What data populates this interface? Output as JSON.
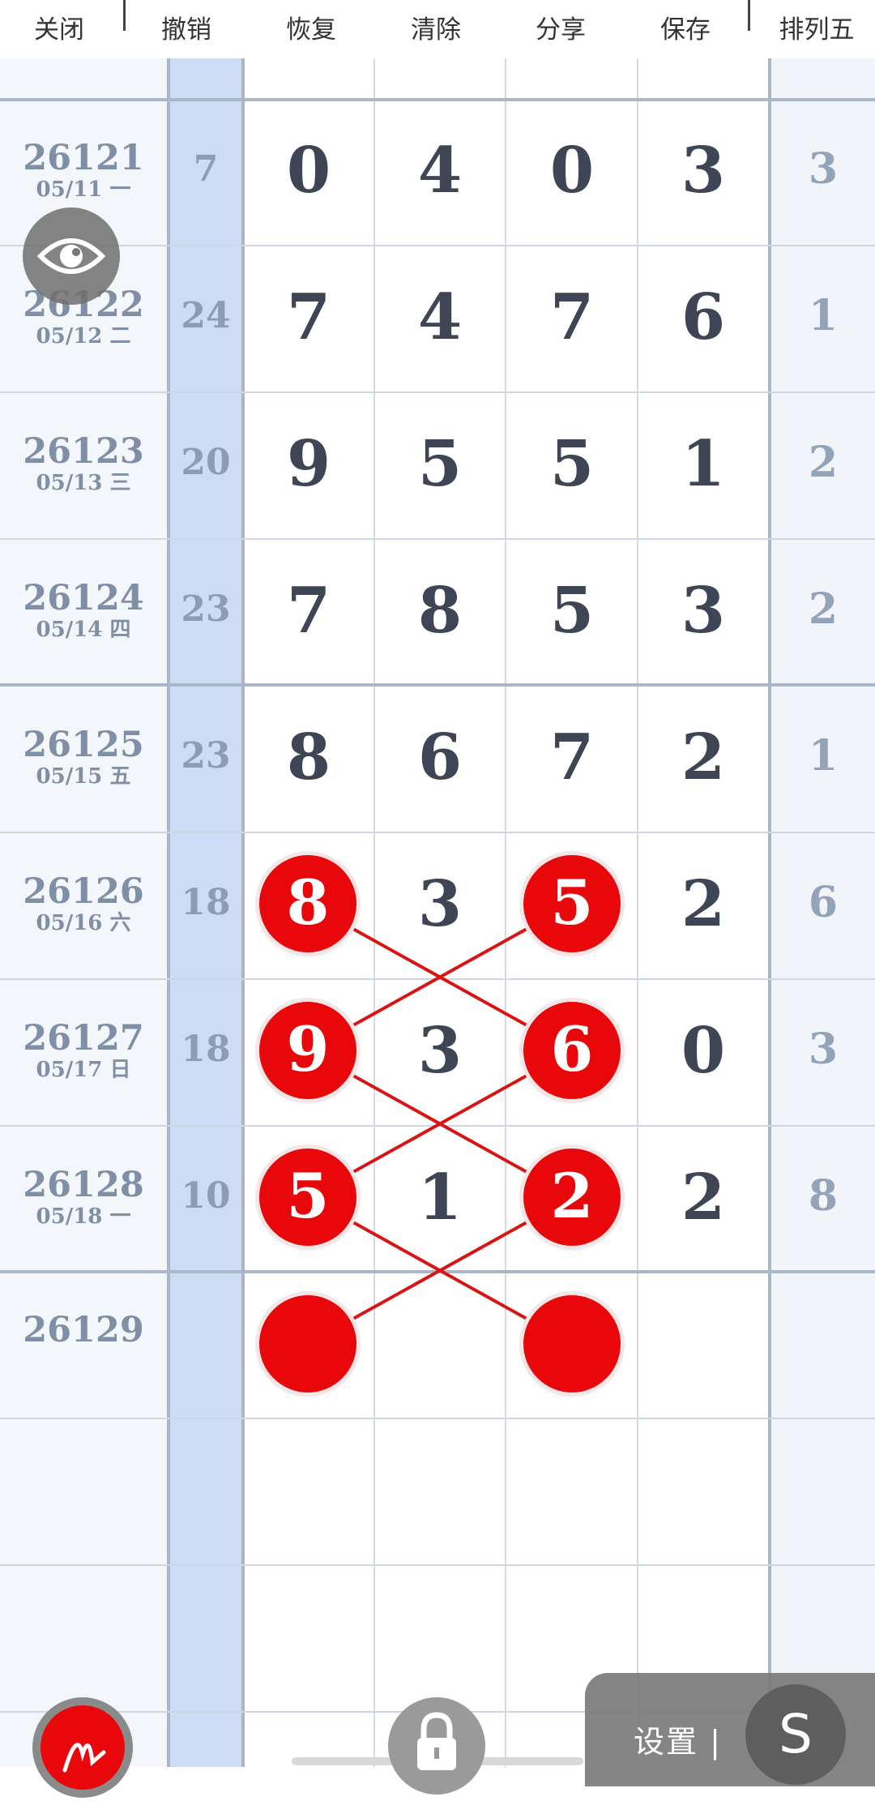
{
  "toolbar": {
    "close": "关闭",
    "undo": "撤销",
    "redo": "恢复",
    "clear": "清除",
    "share": "分享",
    "save": "保存",
    "lottery_name": "排列五"
  },
  "rows": [
    {
      "issue": "26121",
      "date": "05/11 一",
      "sum": "7",
      "d1": "0",
      "d2": "4",
      "d3": "0",
      "d4": "3",
      "p5": "3"
    },
    {
      "issue": "26122",
      "date": "05/12 二",
      "sum": "24",
      "d1": "7",
      "d2": "4",
      "d3": "7",
      "d4": "6",
      "p5": "1"
    },
    {
      "issue": "26123",
      "date": "05/13 三",
      "sum": "20",
      "d1": "9",
      "d2": "5",
      "d3": "5",
      "d4": "1",
      "p5": "2"
    },
    {
      "issue": "26124",
      "date": "05/14 四",
      "sum": "23",
      "d1": "7",
      "d2": "8",
      "d3": "5",
      "d4": "3",
      "p5": "2"
    },
    {
      "issue": "26125",
      "date": "05/15 五",
      "sum": "23",
      "d1": "8",
      "d2": "6",
      "d3": "7",
      "d4": "2",
      "p5": "1"
    },
    {
      "issue": "26126",
      "date": "05/16 六",
      "sum": "18",
      "d1": "8",
      "d2": "3",
      "d3": "5",
      "d4": "2",
      "p5": "6"
    },
    {
      "issue": "26127",
      "date": "05/17 日",
      "sum": "18",
      "d1": "9",
      "d2": "3",
      "d3": "6",
      "d4": "0",
      "p5": "3"
    },
    {
      "issue": "26128",
      "date": "05/18 一",
      "sum": "10",
      "d1": "5",
      "d2": "1",
      "d3": "2",
      "d4": "2",
      "p5": "8"
    },
    {
      "issue": "26129",
      "date": "",
      "sum": "",
      "d1": "",
      "d2": "",
      "d3": "",
      "d4": "",
      "p5": ""
    }
  ],
  "settings_label": "设置",
  "settings_button_letter": "S",
  "colors": {
    "ball": "#e8080c",
    "sum_column": "#ccdcf4",
    "line": "#d81414"
  },
  "icons": {
    "eye": "eye-icon",
    "lock": "lock-icon",
    "pen": "pen-icon",
    "s_logo": "s-icon"
  }
}
